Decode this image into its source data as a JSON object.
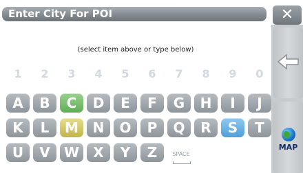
{
  "title": "Enter City For POI",
  "close_label": "✕",
  "hint": "(select item above or type below)",
  "digits": [
    "1",
    "2",
    "3",
    "4",
    "5",
    "6",
    "7",
    "8",
    "9",
    "0"
  ],
  "rows": [
    [
      "A",
      "B",
      "C",
      "D",
      "E",
      "F",
      "G",
      "H",
      "I",
      "J"
    ],
    [
      "K",
      "L",
      "M",
      "N",
      "O",
      "P",
      "Q",
      "R",
      "S",
      "T"
    ],
    [
      "U",
      "V",
      "W",
      "X",
      "Y",
      "Z"
    ]
  ],
  "space_label": "SPACE",
  "map_label": "MAP",
  "highlight_colors": {
    "C": "#6fba63",
    "M": "#d3c865",
    "S": "#67b1e6"
  }
}
